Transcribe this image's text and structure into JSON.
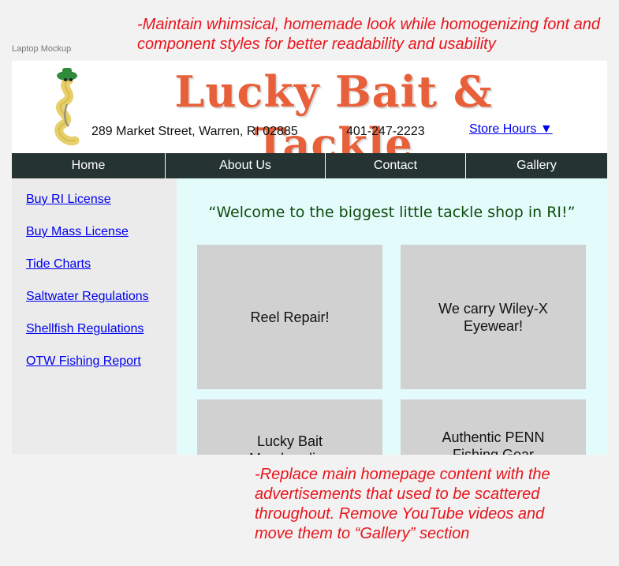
{
  "annotations": {
    "top_note": "-Maintain whimsical, homemade look while homogenizing font and component styles for better readability and usability",
    "bottom_note": "-Replace main homepage content with the advertisements that used to be scattered throughout. Remove YouTube videos and move them to “Gallery” section"
  },
  "frame_label": "Laptop Mockup",
  "header": {
    "brand_name": "Lucky Bait & Tackle",
    "address": "289 Market Street, Warren, RI 02885",
    "phone": "401-247-2223",
    "store_hours_label": "Store Hours ▼"
  },
  "nav": {
    "items": [
      "Home",
      "About Us",
      "Contact",
      "Gallery"
    ]
  },
  "sidebar": {
    "links": [
      "Buy RI License",
      "Buy Mass License",
      "Tide Charts",
      "Saltwater Regulations",
      "Shellfish Regulations",
      "OTW Fishing Report"
    ]
  },
  "main": {
    "welcome": "“Welcome to the biggest little tackle shop in RI!”",
    "cards": [
      "Reel Repair!",
      "We carry Wiley-X Eyewear!",
      "Lucky Bait Merchandise",
      "Authentic PENN Fishing Gear"
    ]
  },
  "colors": {
    "brand": "#e8603a",
    "nav_bg": "#253333",
    "main_bg": "#e4fbfb",
    "sidebar_bg": "#ebebeb",
    "card_bg": "#d1d1d1",
    "note_red": "#e8141c",
    "link_blue": "#0000ee",
    "welcome_green": "#0e4d0e"
  },
  "icons": {
    "mascot": "worm-mascot-icon"
  }
}
